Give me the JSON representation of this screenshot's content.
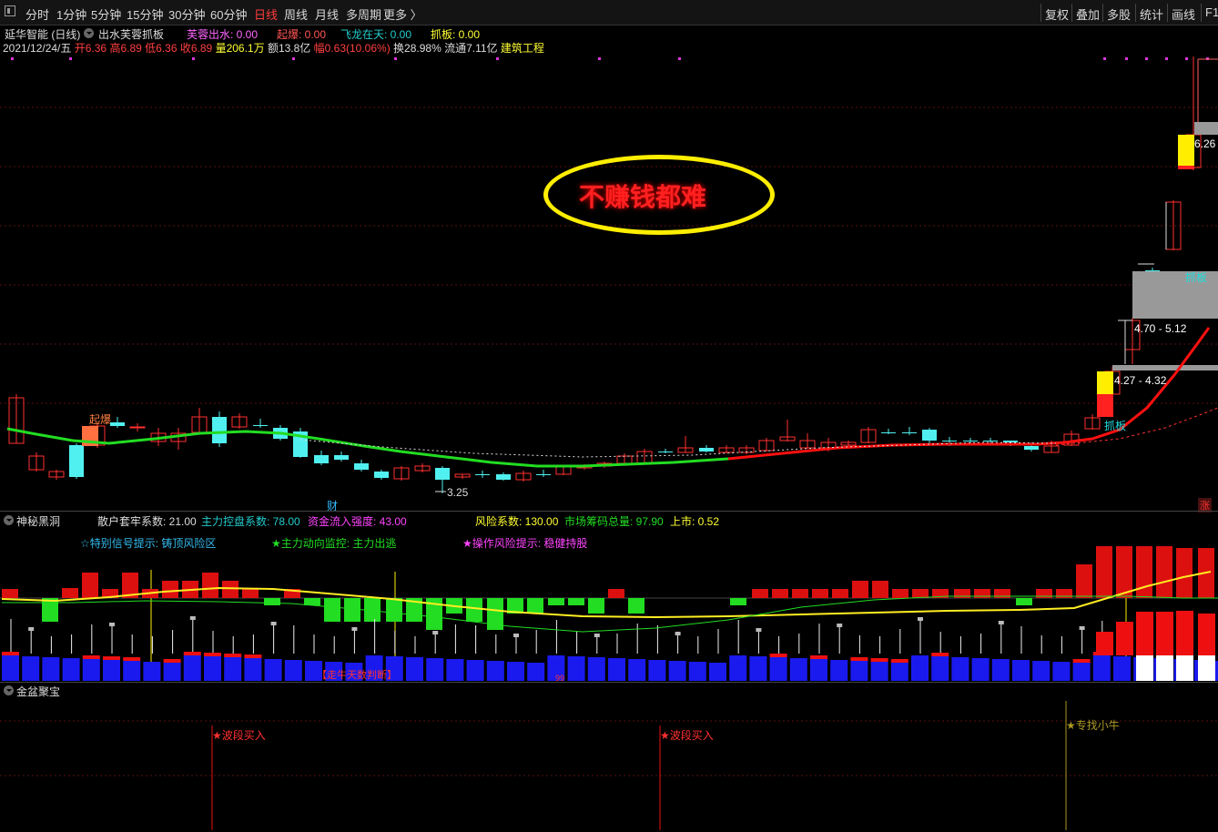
{
  "toolbar": {
    "periods": [
      "分时",
      "1分钟",
      "5分钟",
      "15分钟",
      "30分钟",
      "60分钟",
      "日线",
      "周线",
      "月线",
      "多周期",
      "更多 〉"
    ],
    "active_period": "日线",
    "right_buttons": [
      "复权",
      "叠加",
      "多股",
      "统计",
      "画线",
      "F1"
    ]
  },
  "main_pane": {
    "stock_title": "延华智能 (日线)",
    "indicator_name": "出水芙蓉抓板",
    "indicators": [
      {
        "label": "芙蓉出水: 0.00",
        "color": "#ff66ff"
      },
      {
        "label": "起爆: 0.00",
        "color": "#ff5555"
      },
      {
        "label": "飞龙在天: 0.00",
        "color": "#22cccc"
      },
      {
        "label": "抓板: 0.00",
        "color": "#ffff33"
      }
    ],
    "info_date": "2021/12/24/五",
    "info_open": "开6.36",
    "info_high": "高6.89",
    "info_low": "低6.36",
    "info_close": "收6.89",
    "info_volume": "量206.1万",
    "info_amount": "额13.8亿",
    "info_range": "幅0.63(10.06%)",
    "info_turnover": "换28.98%",
    "info_float": "流通7.11亿",
    "info_industry": "建筑工程",
    "banner_text": "不赚钱都难",
    "price_label_top": "6.26",
    "zone_label_1": "4.70 - 5.12",
    "zone_label_2": "4.27 - 4.32",
    "signal_zhuaban": "抓板",
    "signal_zhuaban_2": "抓板",
    "signal_qibao": "起爆",
    "low_label": "3.25",
    "cai_marker": "财",
    "zhang_marker": "涨",
    "colors": {
      "up": "#ff3030",
      "down": "#50f0f0",
      "ma_up": "#ff1010",
      "ma_down": "#22dd22",
      "banner_ring": "#ffee00",
      "banner_text": "#ff2020"
    }
  },
  "pane2": {
    "title": "神秘黑洞",
    "metrics": [
      {
        "label": "散户套牢系数: 21.00",
        "color": "#dddddd"
      },
      {
        "label": "主力控盘系数: 78.00",
        "color": "#22cccc"
      },
      {
        "label": "资金流入强度: 43.00",
        "color": "#ff44ff"
      },
      {
        "label": "风险系数: 130.00",
        "color": "#ffff33"
      },
      {
        "label": "市场筹码总量: 97.90",
        "color": "#22dd22"
      },
      {
        "label": "上市: 0.52",
        "color": "#ffff33"
      }
    ],
    "hints": [
      {
        "label": "☆特别信号提示:  铸顶风险区",
        "color": "#33bbee"
      },
      {
        "label": "★主力动向监控:  主力出逃",
        "color": "#22dd22"
      },
      {
        "label": "★操作风险提示:  稳健持股",
        "color": "#ff44ff"
      }
    ],
    "bottom_label": "【走牛天数判断】",
    "small_mark": "99"
  },
  "pane3": {
    "title": "金盆聚宝",
    "signals": [
      "★波段买入",
      "★波段买入",
      "★专找小牛"
    ]
  }
}
